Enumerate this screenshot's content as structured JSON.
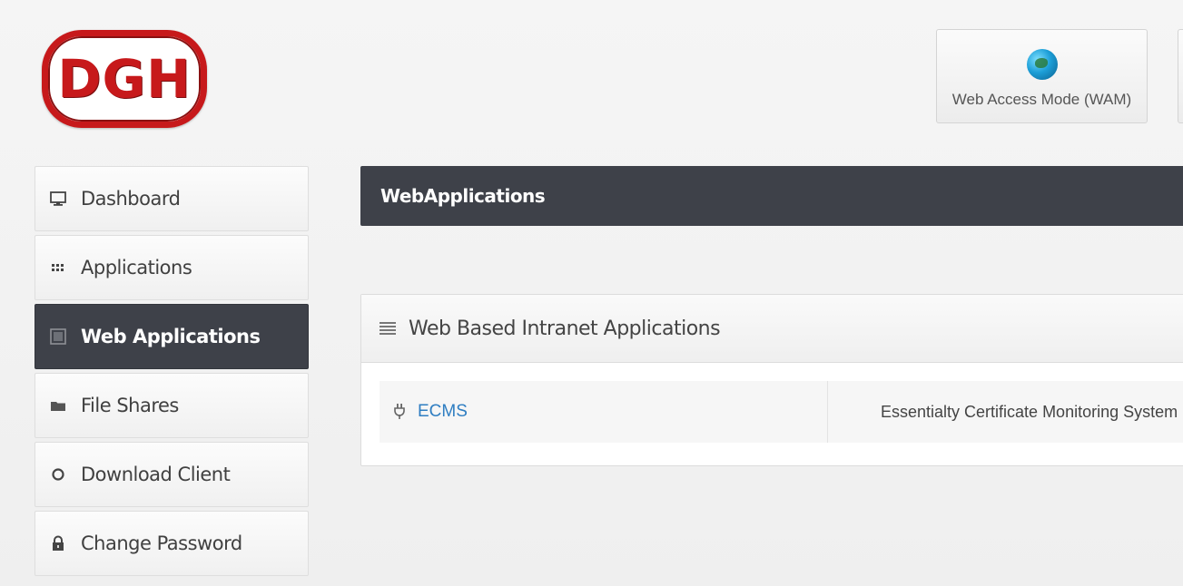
{
  "logo": {
    "text": "DGH"
  },
  "header": {
    "wam_button_label": "Web Access Mode (WAM)"
  },
  "sidebar": {
    "items": [
      {
        "label": "Dashboard",
        "icon": "monitor-icon",
        "active": false
      },
      {
        "label": "Applications",
        "icon": "grid-icon",
        "active": false
      },
      {
        "label": "Web Applications",
        "icon": "web-app-icon",
        "active": true
      },
      {
        "label": "File Shares",
        "icon": "folder-icon",
        "active": false
      },
      {
        "label": "Download Client",
        "icon": "circle-icon",
        "active": false
      },
      {
        "label": "Change Password",
        "icon": "lock-icon",
        "active": false
      }
    ]
  },
  "main": {
    "title": "WebApplications",
    "panel": {
      "title": "Web Based Intranet Applications",
      "apps": [
        {
          "name": "ECMS",
          "description": "Essentialty Certificate Monitoring System O"
        }
      ]
    }
  }
}
